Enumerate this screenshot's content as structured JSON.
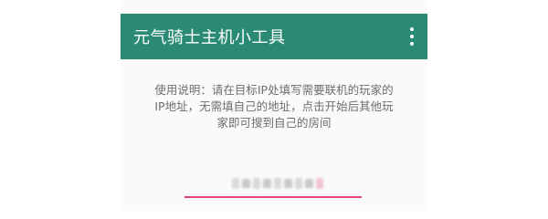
{
  "app": {
    "title": "元气骑士主机小工具",
    "overflow_icon": "more-vert-icon",
    "accent_color": "#2b8a74"
  },
  "instructions": {
    "line1": "使用说明：请在目标IP处填写需要联机的玩家的",
    "line2": "IP地址，无需填自己的地址，点击开始后其他玩",
    "line3": "家即可搜到自己的房间"
  },
  "ip_field": {
    "underline_color": "#e0457c"
  }
}
